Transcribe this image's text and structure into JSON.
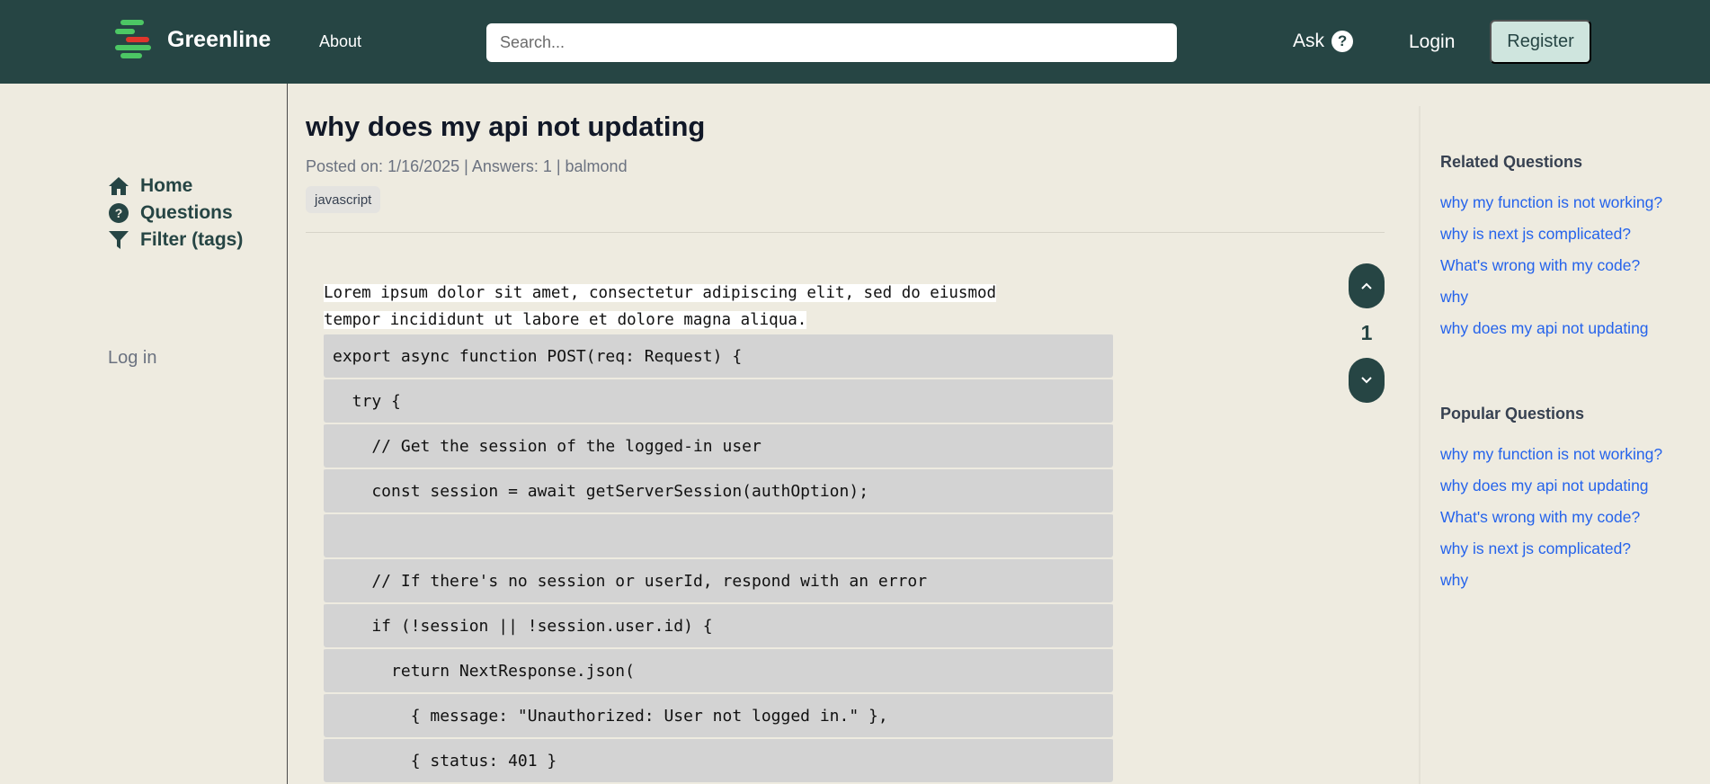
{
  "header": {
    "brand": "Greenline",
    "about_label": "About",
    "search_placeholder": "Search...",
    "ask_label": "Ask",
    "ask_icon_glyph": "?",
    "login_label": "Login",
    "register_label": "Register"
  },
  "sidebar": {
    "items": [
      {
        "label": "Home",
        "icon": "home-icon"
      },
      {
        "label": "Questions",
        "icon": "question-circle-icon"
      },
      {
        "label": "Filter (tags)",
        "icon": "filter-icon"
      }
    ],
    "login_label": "Log in"
  },
  "question": {
    "title": "why does my api not updating",
    "meta": "Posted on: 1/16/2025 | Answers: 1 | balmond",
    "tag": "javascript",
    "body_line1": "Lorem ipsum dolor sit amet, consectetur adipiscing elit, sed do eiusmod",
    "body_line2": "tempor incididunt ut labore et dolore magna aliqua. ",
    "code_lines": [
      "export async function POST(req: Request) {",
      "  try {",
      "    // Get the session of the logged-in user",
      "    const session = await getServerSession(authOption);",
      "",
      "    // If there's no session or userId, respond with an error",
      "    if (!session || !session.user.id) {",
      "      return NextResponse.json(",
      "        { message: \"Unauthorized: User not logged in.\" },",
      "        { status: 401 }"
    ],
    "votes": "1"
  },
  "related": {
    "heading": "Related Questions",
    "items": [
      "why my function is not working?",
      "why is next js complicated?",
      "What's wrong with my code?",
      "why",
      "why does my api not updating"
    ]
  },
  "popular": {
    "heading": "Popular Questions",
    "items": [
      "why my function is not working?",
      "why does my api not updating",
      "What's wrong with my code?",
      "why is next js complicated?",
      "why"
    ]
  },
  "colors": {
    "header_bg": "#264544",
    "page_bg": "#eeebe0",
    "register_bg": "#cfe5de",
    "link_blue": "#2563eb",
    "code_bg": "#d3d3d3"
  }
}
